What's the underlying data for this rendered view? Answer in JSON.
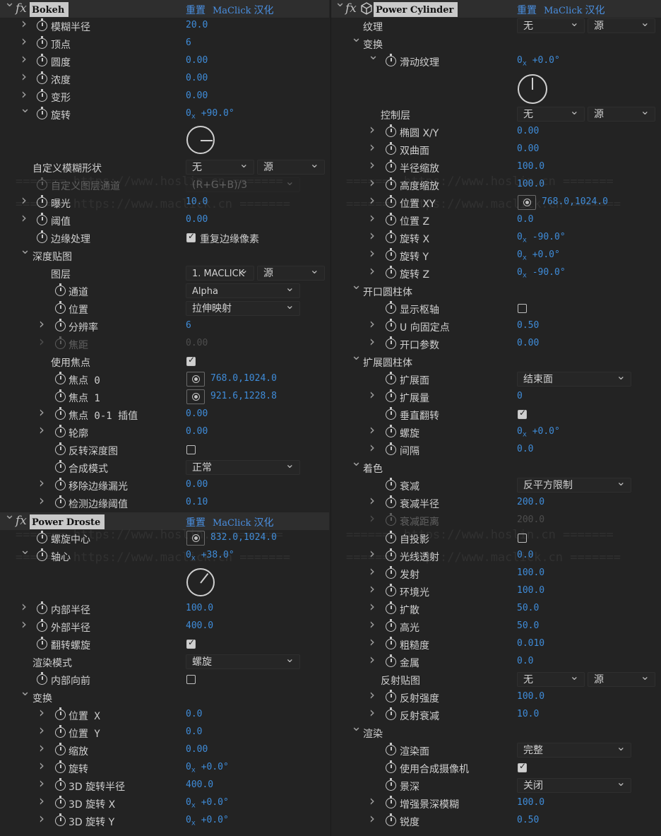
{
  "bokeh": {
    "title": "Bokeh",
    "reset": "重置",
    "maclick": "MaClick",
    "hanhua": "汉化",
    "blur_radius": {
      "label": "模糊半径",
      "value": "20.0"
    },
    "vertices": {
      "label": "顶点",
      "value": "6"
    },
    "roundness": {
      "label": "圆度",
      "value": "0.00"
    },
    "density": {
      "label": "浓度",
      "value": "0.00"
    },
    "deform": {
      "label": "变形",
      "value": "0.00"
    },
    "rotation": {
      "label": "旋转",
      "turns": "0",
      "sub": "x",
      "deg": "+90.0°",
      "angle": 90
    },
    "custom_shape": {
      "label": "自定义模糊形状",
      "layer": "无",
      "source": "源"
    },
    "custom_channel": {
      "label": "自定义图层通道",
      "value": "(R+G+B)/3"
    },
    "exposure": {
      "label": "曝光",
      "value": "10.0"
    },
    "threshold": {
      "label": "阈值",
      "value": "0.00"
    },
    "edge": {
      "label": "边缘处理",
      "checkbox_label": "重复边缘像素",
      "checked": true
    },
    "depth_map": {
      "label": "深度贴图",
      "layer": {
        "label": "图层",
        "value": "1. MACLICK",
        "source": "源"
      },
      "channel": {
        "label": "通道",
        "value": "Alpha"
      },
      "position": {
        "label": "位置",
        "value": "拉伸映射"
      },
      "resolution": {
        "label": "分辨率",
        "value": "6"
      },
      "focal": {
        "label": "焦距",
        "value": "0.00"
      },
      "use_focus": {
        "label": "使用焦点",
        "checked": true
      },
      "focus0": {
        "label": "焦点 0",
        "value": "768.0,1024.0"
      },
      "focus1": {
        "label": "焦点 1",
        "value": "921.6,1228.8"
      },
      "focus_interp": {
        "label": "焦点 0-1 插值",
        "value": "0.00"
      },
      "contour": {
        "label": "轮廓",
        "value": "0.00"
      },
      "invert": {
        "label": "反转深度图",
        "checked": false
      },
      "blend_mode": {
        "label": "合成模式",
        "value": "正常"
      },
      "remove_edge": {
        "label": "移除边缘漏光",
        "value": "0.00"
      },
      "detect_edge": {
        "label": "检测边缘阈值",
        "value": "0.10"
      }
    }
  },
  "droste": {
    "title": "Power Droste",
    "reset": "重置",
    "maclick": "MaClick",
    "hanhua": "汉化",
    "spiral_center": {
      "label": "螺旋中心",
      "value": "832.0,1024.0"
    },
    "axis": {
      "label": "轴心",
      "turns": "0",
      "sub": "x",
      "deg": "+38.0°",
      "angle": 38
    },
    "inner_radius": {
      "label": "内部半径",
      "value": "100.0"
    },
    "outer_radius": {
      "label": "外部半径",
      "value": "400.0"
    },
    "flip_spiral": {
      "label": "翻转螺旋",
      "checked": true
    },
    "render_mode": {
      "label": "渲染模式",
      "value": "螺旋"
    },
    "inward": {
      "label": "内部向前",
      "checked": false
    },
    "transform": {
      "label": "变换",
      "pos_x": {
        "label": "位置 X",
        "value": "0.0"
      },
      "pos_y": {
        "label": "位置 Y",
        "value": "0.0"
      },
      "scale": {
        "label": "缩放",
        "value": "0.00"
      },
      "rotate": {
        "label": "旋转",
        "turns": "0",
        "sub": "x",
        "deg": "+0.0°"
      },
      "rot3d_radius": {
        "label": "3D 旋转半径",
        "value": "400.0"
      },
      "rot3d_x": {
        "label": "3D 旋转 X",
        "turns": "0",
        "sub": "x",
        "deg": "+0.0°"
      },
      "rot3d_y": {
        "label": "3D 旋转 Y",
        "turns": "0",
        "sub": "x",
        "deg": "+0.0°"
      }
    }
  },
  "cylinder": {
    "title": "Power Cylinder",
    "reset": "重置",
    "maclick": "MaClick",
    "hanhua": "汉化",
    "texture": {
      "label": "纹理",
      "value": "无",
      "source": "源"
    },
    "transform": {
      "label": "变换",
      "slide": {
        "label": "滑动纹理",
        "turns": "0",
        "sub": "x",
        "deg": "+0.0°",
        "angle": 0
      },
      "control_layer": {
        "label": "控制层",
        "value": "无",
        "source": "源"
      },
      "ellipse": {
        "label": "椭圆 X/Y",
        "value": "0.00"
      },
      "hyperbolic": {
        "label": "双曲面",
        "value": "0.00"
      },
      "radius_scale": {
        "label": "半径缩放",
        "value": "100.0"
      },
      "height_scale": {
        "label": "高度缩放",
        "value": "100.0"
      },
      "pos_xy": {
        "label": "位置 XY",
        "value": "768.0,1024.0"
      },
      "pos_z": {
        "label": "位置 Z",
        "value": "0.0"
      },
      "rot_x": {
        "label": "旋转 X",
        "turns": "0",
        "sub": "x",
        "deg": "-90.0°"
      },
      "rot_y": {
        "label": "旋转 Y",
        "turns": "0",
        "sub": "x",
        "deg": "+0.0°"
      },
      "rot_z": {
        "label": "旋转 Z",
        "turns": "0",
        "sub": "x",
        "deg": "-90.0°"
      }
    },
    "open_cylinder": {
      "label": "开口圆柱体",
      "show_axis": {
        "label": "显示枢轴",
        "checked": false
      },
      "u_anchor": {
        "label": "U 向固定点",
        "value": "0.50"
      },
      "open_param": {
        "label": "开口参数",
        "value": "0.00"
      }
    },
    "extend_cylinder": {
      "label": "扩展圆柱体",
      "extend_face": {
        "label": "扩展面",
        "value": "结束面"
      },
      "extend_amount": {
        "label": "扩展量",
        "value": "0"
      },
      "vflip": {
        "label": "垂直翻转",
        "checked": true
      },
      "spiral": {
        "label": "螺旋",
        "turns": "0",
        "sub": "x",
        "deg": "+0.0°"
      },
      "gap": {
        "label": "间隔",
        "value": "0.0"
      }
    },
    "shading": {
      "label": "着色",
      "falloff": {
        "label": "衰减",
        "value": "反平方限制"
      },
      "falloff_radius": {
        "label": "衰减半径",
        "value": "200.0"
      },
      "falloff_dist": {
        "label": "衰减距离",
        "value": "200.0"
      },
      "self_shadow": {
        "label": "自投影",
        "checked": false
      },
      "transmission": {
        "label": "光线透射",
        "value": "0.0"
      },
      "emission": {
        "label": "发射",
        "value": "100.0"
      },
      "ambient": {
        "label": "环境光",
        "value": "100.0"
      },
      "diffuse": {
        "label": "扩散",
        "value": "50.0"
      },
      "specular": {
        "label": "高光",
        "value": "50.0"
      },
      "roughness": {
        "label": "粗糙度",
        "value": "0.010"
      },
      "metal": {
        "label": "金属",
        "value": "0.0"
      },
      "refl_map": {
        "label": "反射贴图",
        "value": "无",
        "source": "源"
      },
      "refl_strength": {
        "label": "反射强度",
        "value": "100.0"
      },
      "refl_falloff": {
        "label": "反射衰减",
        "value": "10.0"
      }
    },
    "render": {
      "label": "渲染",
      "render_face": {
        "label": "渲染面",
        "value": "完整"
      },
      "use_camera": {
        "label": "使用合成摄像机",
        "checked": true
      },
      "dof": {
        "label": "景深",
        "value": "关闭"
      },
      "enhance_dof": {
        "label": "增强景深模糊",
        "value": "100.0"
      },
      "sharpness": {
        "label": "锐度",
        "value": "0.50"
      }
    }
  },
  "watermark": {
    "line1": "======= https://www.hoslin.cn =======",
    "line2": "======= https://www.maclick.cn ======="
  }
}
